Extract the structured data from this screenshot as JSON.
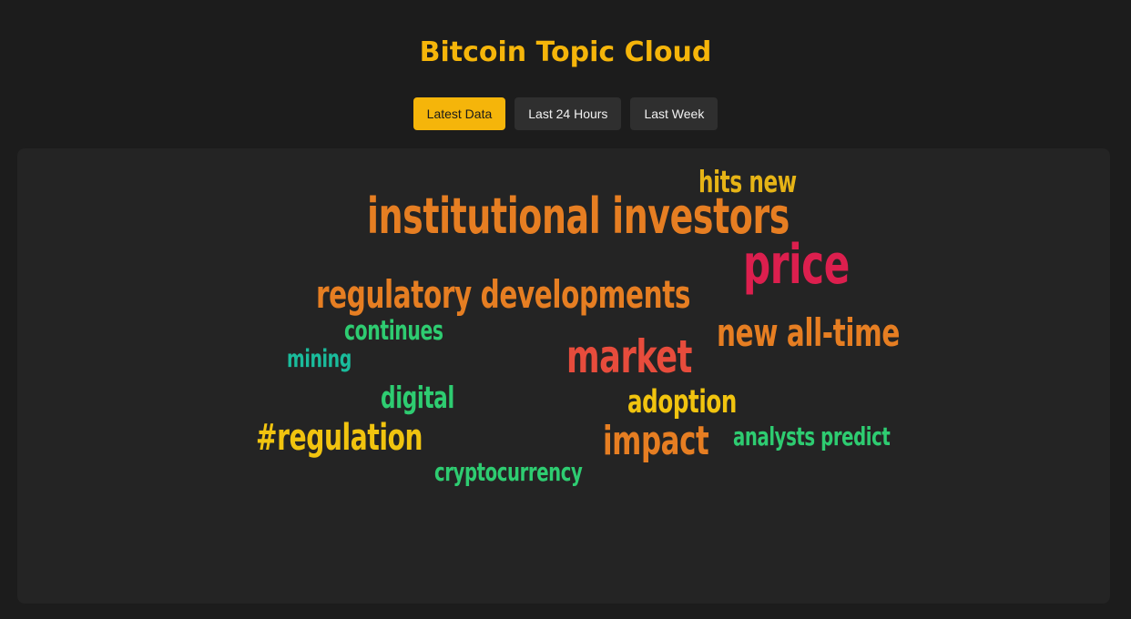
{
  "page": {
    "title": "Bitcoin Topic Cloud"
  },
  "time_range_buttons": [
    {
      "label": "Latest Data",
      "active": true
    },
    {
      "label": "Last 24 Hours",
      "active": false
    },
    {
      "label": "Last Week",
      "active": false
    }
  ],
  "colors": {
    "background": "#1c1c1c",
    "panel": "#242424",
    "accent": "#f5b50a",
    "button_inactive": "#2f2f2f"
  },
  "word_cloud": {
    "words": [
      {
        "text": "hits new",
        "color": "#e6b416"
      },
      {
        "text": "institutional investors",
        "color": "#e67e22"
      },
      {
        "text": "price",
        "color": "#dc1f4e"
      },
      {
        "text": "regulatory developments",
        "color": "#e67e22"
      },
      {
        "text": "new all-time",
        "color": "#e67e22"
      },
      {
        "text": "continues",
        "color": "#2ecc71"
      },
      {
        "text": "mining",
        "color": "#1abc9c"
      },
      {
        "text": "market",
        "color": "#e74c3c"
      },
      {
        "text": "digital",
        "color": "#2ecc71"
      },
      {
        "text": "adoption",
        "color": "#f1c40f"
      },
      {
        "text": "#regulation",
        "color": "#f1c40f"
      },
      {
        "text": "impact",
        "color": "#e67e22"
      },
      {
        "text": "analysts predict",
        "color": "#2ecc71"
      },
      {
        "text": "cryptocurrency",
        "color": "#2ecc71"
      }
    ]
  }
}
